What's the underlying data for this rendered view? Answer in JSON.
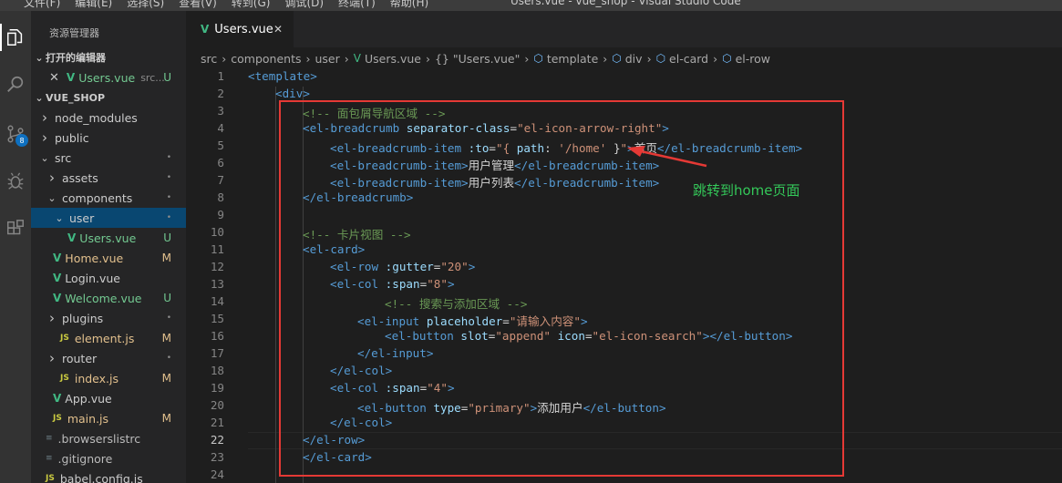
{
  "window": {
    "title": "Users.vue - vue_shop - Visual Studio Code",
    "menu": [
      "文件(F)",
      "编辑(E)",
      "选择(S)",
      "查看(V)",
      "转到(G)",
      "调试(D)",
      "终端(T)",
      "帮助(H)"
    ]
  },
  "activity": {
    "source_control_badge": "8"
  },
  "sidebar": {
    "title": "资源管理器",
    "open_editors_label": "打开的编辑器",
    "open_file": {
      "name": "Users.vue",
      "path": "src...",
      "status": "U"
    },
    "project_label": "VUE_SHOP",
    "tree": [
      {
        "name": "node_modules",
        "type": "folder",
        "status": ""
      },
      {
        "name": "public",
        "type": "folder",
        "status": ""
      },
      {
        "name": "src",
        "type": "folder",
        "status": "•"
      },
      {
        "name": "assets",
        "type": "folder",
        "status": "•"
      },
      {
        "name": "components",
        "type": "folder",
        "status": "•"
      },
      {
        "name": "user",
        "type": "folder",
        "status": "•"
      },
      {
        "name": "Users.vue",
        "type": "vue",
        "status": "U"
      },
      {
        "name": "Home.vue",
        "type": "vue",
        "status": "M"
      },
      {
        "name": "Login.vue",
        "type": "vue",
        "status": ""
      },
      {
        "name": "Welcome.vue",
        "type": "vue",
        "status": "U"
      },
      {
        "name": "plugins",
        "type": "folder",
        "status": "•"
      },
      {
        "name": "element.js",
        "type": "js",
        "status": "M"
      },
      {
        "name": "router",
        "type": "folder",
        "status": "•"
      },
      {
        "name": "index.js",
        "type": "js",
        "status": "M"
      },
      {
        "name": "App.vue",
        "type": "vue",
        "status": ""
      },
      {
        "name": "main.js",
        "type": "js",
        "status": "M"
      },
      {
        "name": ".browserslistrc",
        "type": "dot",
        "status": ""
      },
      {
        "name": ".gitignore",
        "type": "dot",
        "status": ""
      },
      {
        "name": "babel.config.js",
        "type": "js",
        "status": ""
      }
    ]
  },
  "editor": {
    "tab_label": "Users.vue",
    "breadcrumbs": [
      "src",
      "components",
      "user",
      "Users.vue",
      "{} \"Users.vue\"",
      "template",
      "div",
      "el-card",
      "el-row"
    ],
    "annotation": "跳转到home页面",
    "line_numbers": [
      "1",
      "2",
      "3",
      "4",
      "5",
      "6",
      "7",
      "8",
      "9",
      "10",
      "11",
      "12",
      "13",
      "14",
      "15",
      "16",
      "17",
      "18",
      "19",
      "20",
      "21",
      "22",
      "23",
      "24"
    ],
    "lines": [
      [
        [
          "t-tag",
          "<template>"
        ]
      ],
      [
        [
          "t-tag",
          "<div>"
        ]
      ],
      [
        [
          "t-cmt",
          "<!-- 面包屑导航区域 -->"
        ]
      ],
      [
        [
          "t-tag",
          "<el-breadcrumb "
        ],
        [
          "t-attr",
          "separator-class"
        ],
        [
          "t-txt",
          "="
        ],
        [
          "t-str",
          "\"el-icon-arrow-right\""
        ],
        [
          "t-tag",
          ">"
        ]
      ],
      [
        [
          "t-tag",
          "<el-breadcrumb-item "
        ],
        [
          "t-attr",
          ":to"
        ],
        [
          "t-txt",
          "="
        ],
        [
          "t-str",
          "\"{ "
        ],
        [
          "t-attr",
          "path"
        ],
        [
          "t-txt",
          ": "
        ],
        [
          "t-str",
          "'/home' "
        ],
        [
          "t-txt",
          "}"
        ],
        [
          "t-str",
          "\""
        ],
        [
          "t-tag",
          ">"
        ],
        [
          "t-txt",
          "首页"
        ],
        [
          "t-tag",
          "</el-breadcrumb-item>"
        ]
      ],
      [
        [
          "t-tag",
          "<el-breadcrumb-item>"
        ],
        [
          "t-txt",
          "用户管理"
        ],
        [
          "t-tag",
          "</el-breadcrumb-item>"
        ]
      ],
      [
        [
          "t-tag",
          "<el-breadcrumb-item>"
        ],
        [
          "t-txt",
          "用户列表"
        ],
        [
          "t-tag",
          "</el-breadcrumb-item>"
        ]
      ],
      [
        [
          "t-tag",
          "</el-breadcrumb>"
        ]
      ],
      [],
      [
        [
          "t-cmt",
          "<!-- 卡片视图 -->"
        ]
      ],
      [
        [
          "t-tag",
          "<el-card>"
        ]
      ],
      [
        [
          "t-tag",
          "<el-row "
        ],
        [
          "t-attr",
          ":gutter"
        ],
        [
          "t-txt",
          "="
        ],
        [
          "t-str",
          "\"20\""
        ],
        [
          "t-tag",
          ">"
        ]
      ],
      [
        [
          "t-tag",
          "<el-col "
        ],
        [
          "t-attr",
          ":span"
        ],
        [
          "t-txt",
          "="
        ],
        [
          "t-str",
          "\"8\""
        ],
        [
          "t-tag",
          ">"
        ]
      ],
      [
        [
          "t-cmt",
          "<!-- 搜索与添加区域 -->"
        ]
      ],
      [
        [
          "t-tag",
          "<el-input "
        ],
        [
          "t-attr",
          "placeholder"
        ],
        [
          "t-txt",
          "="
        ],
        [
          "t-str",
          "\"请输入内容\""
        ],
        [
          "t-tag",
          ">"
        ]
      ],
      [
        [
          "t-tag",
          "<el-button "
        ],
        [
          "t-attr",
          "slot"
        ],
        [
          "t-txt",
          "="
        ],
        [
          "t-str",
          "\"append\" "
        ],
        [
          "t-attr",
          "icon"
        ],
        [
          "t-txt",
          "="
        ],
        [
          "t-str",
          "\"el-icon-search\""
        ],
        [
          "t-tag",
          "></el-button>"
        ]
      ],
      [
        [
          "t-tag",
          "</el-input>"
        ]
      ],
      [
        [
          "t-tag",
          "</el-col>"
        ]
      ],
      [
        [
          "t-tag",
          "<el-col "
        ],
        [
          "t-attr",
          ":span"
        ],
        [
          "t-txt",
          "="
        ],
        [
          "t-str",
          "\"4\""
        ],
        [
          "t-tag",
          ">"
        ]
      ],
      [
        [
          "t-tag",
          "<el-button "
        ],
        [
          "t-attr",
          "type"
        ],
        [
          "t-txt",
          "="
        ],
        [
          "t-str",
          "\"primary\""
        ],
        [
          "t-tag",
          ">"
        ],
        [
          "t-txt",
          "添加用户"
        ],
        [
          "t-tag",
          "</el-button>"
        ]
      ],
      [
        [
          "t-tag",
          "</el-col>"
        ]
      ],
      [
        [
          "t-tag",
          "</el-row>"
        ]
      ],
      [
        [
          "t-tag",
          "</el-card>"
        ]
      ],
      []
    ],
    "indents": [
      0,
      1,
      2,
      2,
      3,
      3,
      3,
      2,
      0,
      2,
      2,
      3,
      3,
      5,
      4,
      5,
      4,
      3,
      3,
      4,
      3,
      2,
      2,
      0
    ],
    "cursor_line": 22
  }
}
